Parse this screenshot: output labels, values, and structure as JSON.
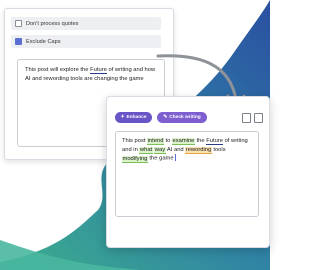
{
  "colors": {
    "teal": "#3fb3a6",
    "blue": "#2d59a3",
    "green_highlight": "#d9f2c8",
    "orange_highlight": "#fbe1b0",
    "button_purple": "#6a55c7"
  },
  "back_card": {
    "options": [
      {
        "label": "Don't process quotes",
        "checked": false
      },
      {
        "label": "Exclude Caps",
        "checked": true
      }
    ],
    "text": {
      "t1": "This post will explore the ",
      "w1": "Future",
      "t2": " of writing and how AI and rewording tools are changing the game"
    }
  },
  "front_card": {
    "enhance_label": "Enhance",
    "check_label": "Check writing",
    "icons": [
      "copy-icon",
      "clipboard-icon"
    ],
    "text": {
      "t1": "This post ",
      "w_intend": "intend",
      "t2": " to ",
      "w_examine": "examine",
      "t3": " the ",
      "w_future": "Future",
      "t4": " of writing and in ",
      "w_what": "what",
      "t5": " ",
      "w_way": "way",
      "t6": " AI and ",
      "w_rewording": "rewording",
      "t7": " tools ",
      "w_modifying": "modifying",
      "t8": " the game"
    }
  }
}
